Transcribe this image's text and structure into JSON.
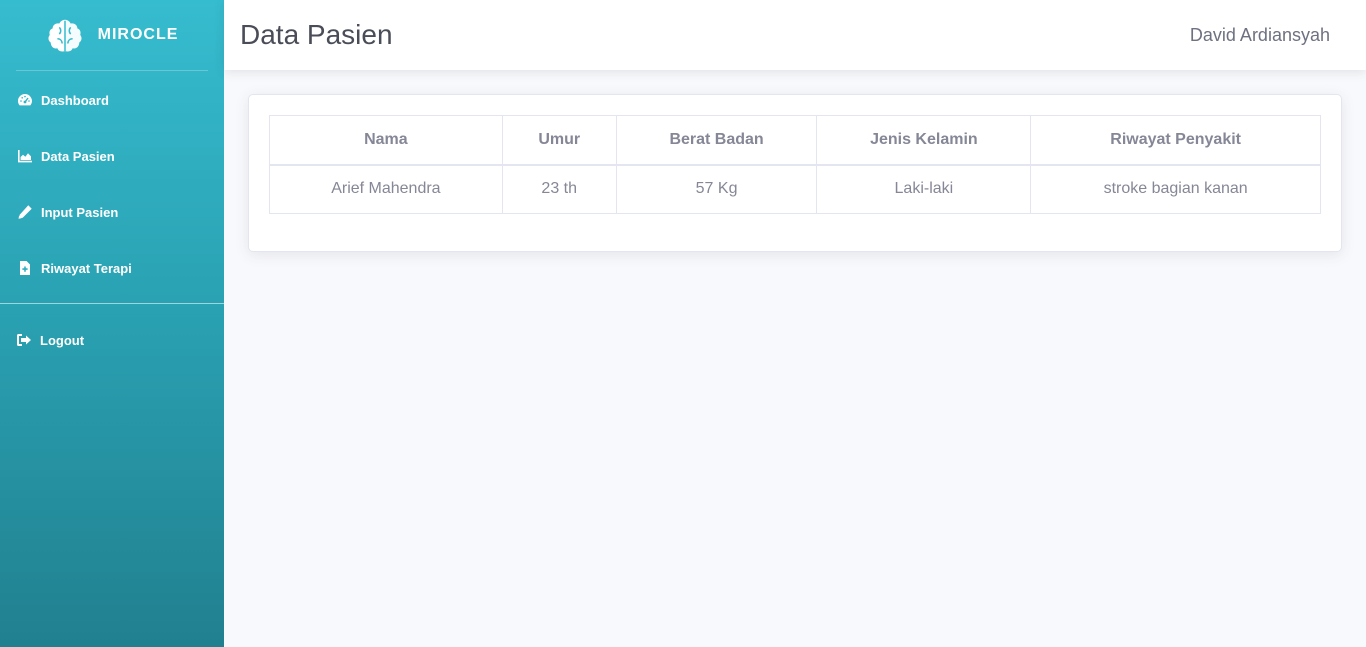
{
  "brand": {
    "name": "MIROCLE",
    "logo_icon": "brain-icon"
  },
  "sidebar": {
    "items": [
      {
        "label": "Dashboard",
        "icon": "tachometer-icon"
      },
      {
        "label": "Data Pasien",
        "icon": "chart-area-icon"
      },
      {
        "label": "Input Pasien",
        "icon": "pencil-icon"
      },
      {
        "label": "Riwayat Terapi",
        "icon": "file-medical-icon"
      }
    ],
    "logout": {
      "label": "Logout",
      "icon": "sign-out-icon"
    }
  },
  "header": {
    "title": "Data Pasien",
    "user": "David Ardiansyah"
  },
  "table": {
    "columns": [
      "Nama",
      "Umur",
      "Berat Badan",
      "Jenis Kelamin",
      "Riwayat Penyakit"
    ],
    "rows": [
      [
        "Arief Mahendra",
        "23 th",
        "57 Kg",
        "Laki-laki",
        "stroke bagian kanan"
      ]
    ]
  },
  "colors": {
    "sidebar_top": "#36bccf",
    "sidebar_bottom": "#21808f",
    "page_bg": "#f8f9fc",
    "table_text": "#858796"
  }
}
